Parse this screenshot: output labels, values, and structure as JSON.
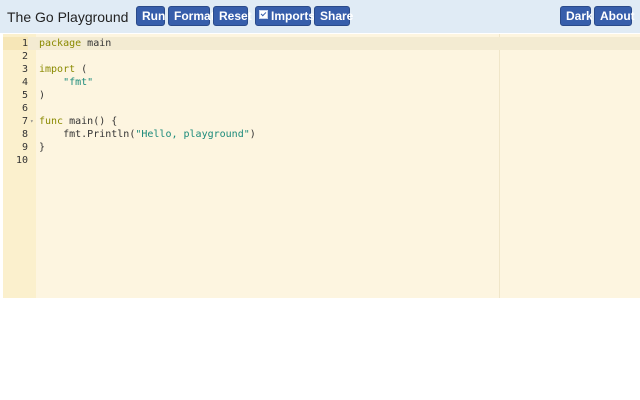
{
  "header": {
    "title": "The Go Playground",
    "buttons": {
      "run": "Run",
      "format": "Format",
      "reset": "Reset",
      "imports": "Imports",
      "share": "Share",
      "dark": "Dark",
      "about": "About"
    },
    "imports_checked": true
  },
  "editor": {
    "line_numbers": [
      "1",
      "2",
      "3",
      "4",
      "5",
      "6",
      "7",
      "8",
      "9",
      "10"
    ],
    "active_line": 1,
    "fold_marker": "▾",
    "tokens": {
      "l1_kw": "package",
      "l1_rest": " main",
      "l3_kw": "import",
      "l3_rest": " (",
      "l4_indent": "    ",
      "l4_str": "\"fmt\"",
      "l5": ")",
      "l7_kw": "func",
      "l7_rest": " main() {",
      "l8_indent": "    ",
      "l8_pre": "fmt.Println(",
      "l8_str": "\"Hello, playground\"",
      "l8_post": ")",
      "l9": "}"
    }
  },
  "colors": {
    "header_bg": "#e0ebf5",
    "button_bg": "#375eab",
    "editor_bg": "#fdf5e0",
    "gutter_bg": "#fbf0cd",
    "keyword": "#8a8a00",
    "string": "#1a8a7a"
  }
}
